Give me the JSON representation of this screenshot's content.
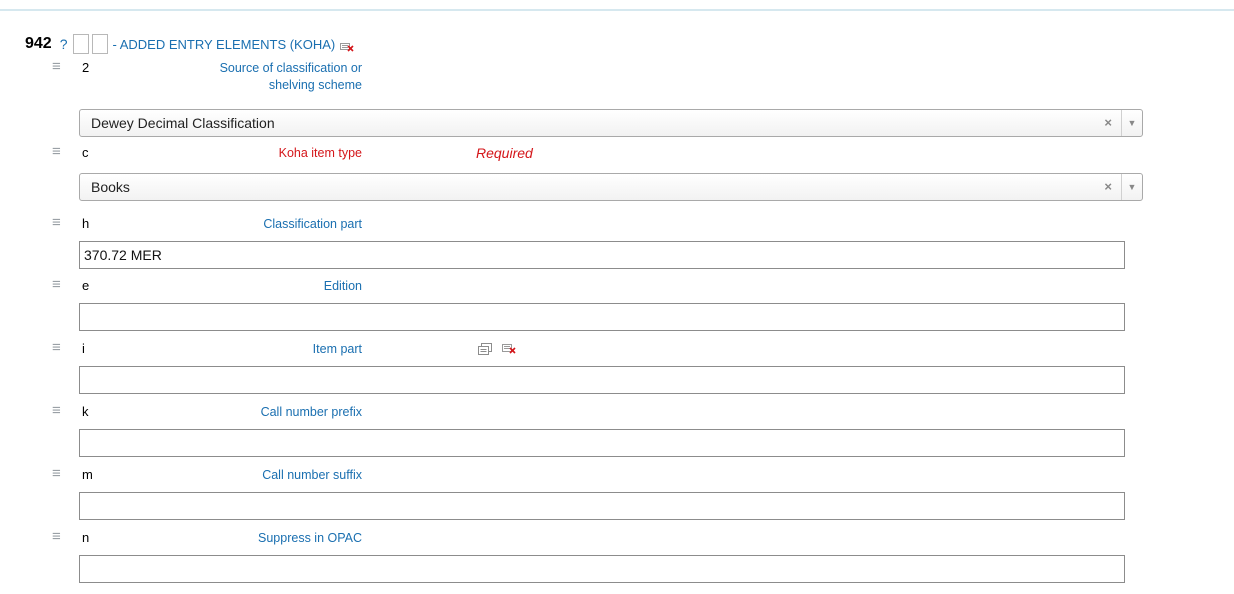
{
  "tag": {
    "number": "942",
    "help": "?",
    "title": "- ADDED ENTRY ELEMENTS (KOHA)",
    "delete_icon": "delete-tag-icon"
  },
  "icons": {
    "drag": "≡",
    "clear": "×",
    "arrow": "▼"
  },
  "subfields": [
    {
      "code": "2",
      "label_line1": "Source of classification or",
      "label_line2": "shelving scheme",
      "value": "Dewey Decimal Classification",
      "kind": "select"
    },
    {
      "code": "c",
      "label": "Koha item type",
      "required_note": "Required",
      "value": "Books",
      "kind": "select"
    },
    {
      "code": "h",
      "label": "Classification part",
      "value": "370.72 MER",
      "kind": "text"
    },
    {
      "code": "e",
      "label": "Edition",
      "value": "",
      "kind": "text"
    },
    {
      "code": "i",
      "label": "Item part",
      "value": "",
      "kind": "text",
      "icons": [
        "clone-subfield-icon",
        "delete-subfield-icon"
      ]
    },
    {
      "code": "k",
      "label": "Call number prefix",
      "value": "",
      "kind": "text"
    },
    {
      "code": "m",
      "label": "Call number suffix",
      "value": "",
      "kind": "text"
    },
    {
      "code": "n",
      "label": "Suppress in OPAC",
      "value": "",
      "kind": "text"
    }
  ],
  "colors": {
    "label_blue": "#1a6fb0",
    "required_red": "#d4161a"
  }
}
